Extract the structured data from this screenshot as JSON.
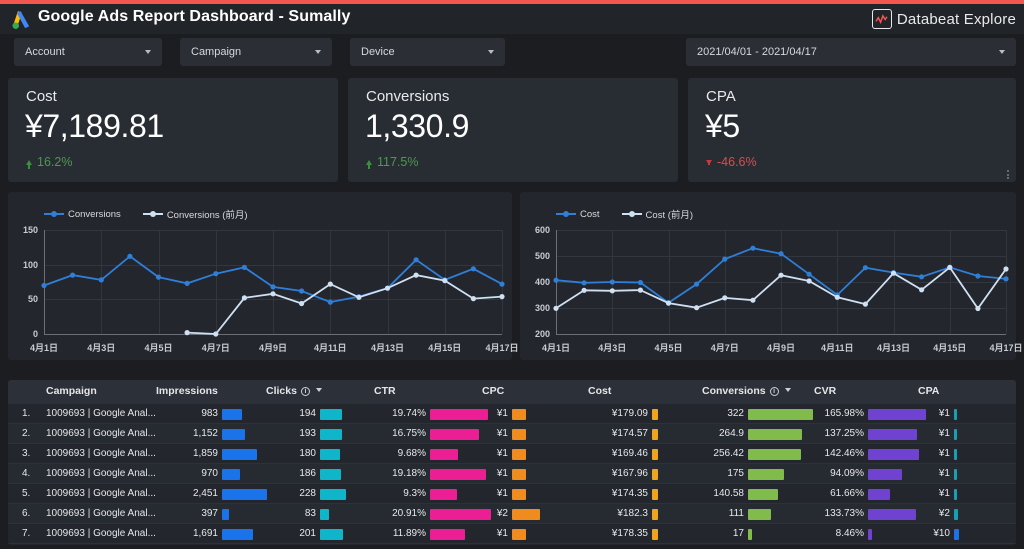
{
  "accent_color": "#f2564e",
  "header": {
    "title": "Google Ads Report Dashboard - Sumally",
    "logo_icon": "google-ads-logo-icon",
    "brand_name": "Databeat Explore",
    "brand_icon": "databeat-chart-icon"
  },
  "filters": [
    {
      "id": "account",
      "label": "Account"
    },
    {
      "id": "campaign",
      "label": "Campaign"
    },
    {
      "id": "device",
      "label": "Device"
    },
    {
      "id": "daterange",
      "label": "2021/04/01 - 2021/04/17"
    }
  ],
  "scorecards": [
    {
      "id": "cost",
      "title": "Cost",
      "value": "¥7,189.81",
      "delta": "16.2%",
      "direction": "up",
      "delta_color": "#4c9a4e"
    },
    {
      "id": "conversions",
      "title": "Conversions",
      "value": "1,330.9",
      "delta": "117.5%",
      "direction": "up",
      "delta_color": "#4c9a4e"
    },
    {
      "id": "cpa",
      "title": "CPA",
      "value": "¥5",
      "delta": "-46.6%",
      "direction": "down",
      "delta_color": "#d2504e"
    }
  ],
  "chart_data": [
    {
      "id": "conversions-chart",
      "type": "line",
      "title": "",
      "xlabel": "",
      "ylabel": "",
      "ylim": [
        0,
        150
      ],
      "yticks": [
        0,
        50,
        100,
        150
      ],
      "grid": true,
      "legend_position": "top-left",
      "x": [
        "4月1日",
        "4月2日",
        "4月3日",
        "4月4日",
        "4月5日",
        "4月6日",
        "4月7日",
        "4月8日",
        "4月9日",
        "4月10日",
        "4月11日",
        "4月12日",
        "4月13日",
        "4月14日",
        "4月15日",
        "4月16日",
        "4月17日"
      ],
      "xticks": [
        "4月1日",
        "4月3日",
        "4月5日",
        "4月7日",
        "4月9日",
        "4月11日",
        "4月13日",
        "4月15日",
        "4月17日"
      ],
      "series": [
        {
          "name": "Conversions",
          "color": "#2f7ed8",
          "values": [
            70,
            85,
            78,
            112,
            82,
            73,
            87,
            96,
            68,
            62,
            46,
            54,
            66,
            107,
            78,
            94,
            72
          ]
        },
        {
          "name": "Conversions (前月)",
          "color": "#cfe0f2",
          "values": [
            null,
            null,
            null,
            null,
            null,
            2,
            0,
            52,
            58,
            44,
            72,
            53,
            66,
            85,
            77,
            51,
            54
          ]
        }
      ]
    },
    {
      "id": "cost-chart",
      "type": "line",
      "title": "",
      "xlabel": "",
      "ylabel": "",
      "ylim": [
        200,
        600
      ],
      "yticks": [
        200,
        300,
        400,
        500,
        600
      ],
      "grid": true,
      "legend_position": "top-left",
      "x": [
        "4月1日",
        "4月2日",
        "4月3日",
        "4月4日",
        "4月5日",
        "4月6日",
        "4月7日",
        "4月8日",
        "4月9日",
        "4月10日",
        "4月11日",
        "4月12日",
        "4月13日",
        "4月14日",
        "4月15日",
        "4月16日",
        "4月17日"
      ],
      "xticks": [
        "4月1日",
        "4月3日",
        "4月5日",
        "4月7日",
        "4月9日",
        "4月11日",
        "4月13日",
        "4月15日",
        "4月17日"
      ],
      "series": [
        {
          "name": "Cost",
          "color": "#2f7ed8",
          "values": [
            407,
            397,
            400,
            398,
            320,
            392,
            488,
            530,
            509,
            430,
            350,
            455,
            436,
            420,
            456,
            423,
            412
          ]
        },
        {
          "name": "Cost (前月)",
          "color": "#cfe0f2",
          "values": [
            299,
            368,
            366,
            369,
            319,
            301,
            339,
            330,
            426,
            404,
            341,
            315,
            434,
            370,
            456,
            298,
            450
          ]
        }
      ]
    }
  ],
  "table": {
    "columns": [
      {
        "key": "rank",
        "label": "",
        "align": "left"
      },
      {
        "key": "campaign",
        "label": "Campaign",
        "align": "left"
      },
      {
        "key": "impressions",
        "label": "Impressions",
        "align": "right",
        "bar_color": "#1a73e8"
      },
      {
        "key": "clicks",
        "label": "Clicks",
        "align": "right",
        "bar_color": "#0fb5c9",
        "info_icon": "info-icon",
        "sort_icon": "chevron-down-icon"
      },
      {
        "key": "ctr",
        "label": "CTR",
        "align": "right",
        "bar_color": "#ec1e94"
      },
      {
        "key": "cpc",
        "label": "CPC",
        "align": "right",
        "bar_color": "#f08c1e"
      },
      {
        "key": "cost",
        "label": "Cost",
        "align": "right",
        "bar_color": "#f0a41e"
      },
      {
        "key": "conversions",
        "label": "Conversions",
        "align": "right",
        "bar_color": "#80bb4b",
        "info_icon": "info-icon",
        "sort_icon": "chevron-down-icon"
      },
      {
        "key": "cvr",
        "label": "CVR",
        "align": "right",
        "bar_color": "#6f42d1"
      },
      {
        "key": "cpa",
        "label": "CPA",
        "align": "right",
        "bar_color": "#16a0b4"
      }
    ],
    "rows": [
      {
        "rank": "1.",
        "campaign": "1009693 | Google Anal...",
        "impressions": "983",
        "impressions_w": 20,
        "clicks": "194",
        "clicks_w": 22,
        "ctr": "19.74%",
        "ctr_w": 58,
        "cpc": "¥1",
        "cpc_w": 14,
        "cost": "¥179.09",
        "cost_w": 6,
        "conversions": "322",
        "conversions_w": 65,
        "cvr": "165.98%",
        "cvr_w": 58,
        "cpa": "¥1",
        "cpa_w": 3,
        "cpa_color": "#16a0b4"
      },
      {
        "rank": "2.",
        "campaign": "1009693 | Google Anal...",
        "impressions": "1,152",
        "impressions_w": 23,
        "clicks": "193",
        "clicks_w": 22,
        "ctr": "16.75%",
        "ctr_w": 49,
        "cpc": "¥1",
        "cpc_w": 14,
        "cost": "¥174.57",
        "cost_w": 6,
        "conversions": "264.9",
        "conversions_w": 54,
        "cvr": "137.25%",
        "cvr_w": 49,
        "cpa": "¥1",
        "cpa_w": 3,
        "cpa_color": "#16a0b4"
      },
      {
        "rank": "3.",
        "campaign": "1009693 | Google Anal...",
        "impressions": "1,859",
        "impressions_w": 35,
        "clicks": "180",
        "clicks_w": 20,
        "ctr": "9.68%",
        "ctr_w": 28,
        "cpc": "¥1",
        "cpc_w": 14,
        "cost": "¥169.46",
        "cost_w": 6,
        "conversions": "256.42",
        "conversions_w": 53,
        "cvr": "142.46%",
        "cvr_w": 51,
        "cpa": "¥1",
        "cpa_w": 3,
        "cpa_color": "#16a0b4"
      },
      {
        "rank": "4.",
        "campaign": "1009693 | Google Anal...",
        "impressions": "970",
        "impressions_w": 18,
        "clicks": "186",
        "clicks_w": 21,
        "ctr": "19.18%",
        "ctr_w": 56,
        "cpc": "¥1",
        "cpc_w": 14,
        "cost": "¥167.96",
        "cost_w": 6,
        "conversions": "175",
        "conversions_w": 36,
        "cvr": "94.09%",
        "cvr_w": 34,
        "cpa": "¥1",
        "cpa_w": 3,
        "cpa_color": "#16a0b4"
      },
      {
        "rank": "5.",
        "campaign": "1009693 | Google Anal...",
        "impressions": "2,451",
        "impressions_w": 45,
        "clicks": "228",
        "clicks_w": 26,
        "ctr": "9.3%",
        "ctr_w": 27,
        "cpc": "¥1",
        "cpc_w": 14,
        "cost": "¥174.35",
        "cost_w": 6,
        "conversions": "140.58",
        "conversions_w": 30,
        "cvr": "61.66%",
        "cvr_w": 22,
        "cpa": "¥1",
        "cpa_w": 3,
        "cpa_color": "#16a0b4"
      },
      {
        "rank": "6.",
        "campaign": "1009693 | Google Anal...",
        "impressions": "397",
        "impressions_w": 7,
        "clicks": "83",
        "clicks_w": 9,
        "ctr": "20.91%",
        "ctr_w": 61,
        "cpc": "¥2",
        "cpc_w": 28,
        "cost": "¥182.3",
        "cost_w": 6,
        "conversions": "111",
        "conversions_w": 23,
        "cvr": "133.73%",
        "cvr_w": 48,
        "cpa": "¥2",
        "cpa_w": 4,
        "cpa_color": "#16a0b4"
      },
      {
        "rank": "7.",
        "campaign": "1009693 | Google Anal...",
        "impressions": "1,691",
        "impressions_w": 31,
        "clicks": "201",
        "clicks_w": 23,
        "ctr": "11.89%",
        "ctr_w": 35,
        "cpc": "¥1",
        "cpc_w": 14,
        "cost": "¥178.35",
        "cost_w": 6,
        "conversions": "17",
        "conversions_w": 4,
        "cvr": "8.46%",
        "cvr_w": 4,
        "cpa": "¥10",
        "cpa_w": 5,
        "cpa_color": "#1a73e8"
      }
    ]
  }
}
